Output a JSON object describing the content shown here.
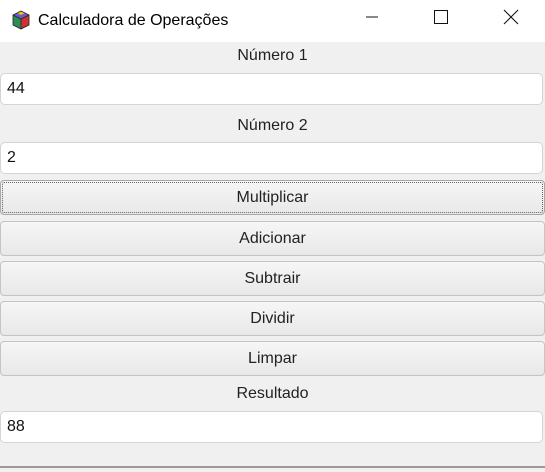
{
  "window": {
    "title": "Calculadora de Operações",
    "icon": "colorful-cube-icon",
    "controls": [
      "minimize-icon",
      "maximize-icon",
      "close-icon"
    ]
  },
  "form": {
    "numero1_label": "Número 1",
    "numero1_value": "44",
    "numero2_label": "Número 2",
    "numero2_value": "2",
    "resultado_label": "Resultado",
    "resultado_value": "88"
  },
  "buttons": {
    "multiplicar": "Multiplicar",
    "adicionar": "Adicionar",
    "subtrair": "Subtrair",
    "dividir": "Dividir",
    "limpar": "Limpar"
  },
  "colors": {
    "window_bg": "#f0f0f0",
    "titlebar_bg": "#ffffff"
  }
}
